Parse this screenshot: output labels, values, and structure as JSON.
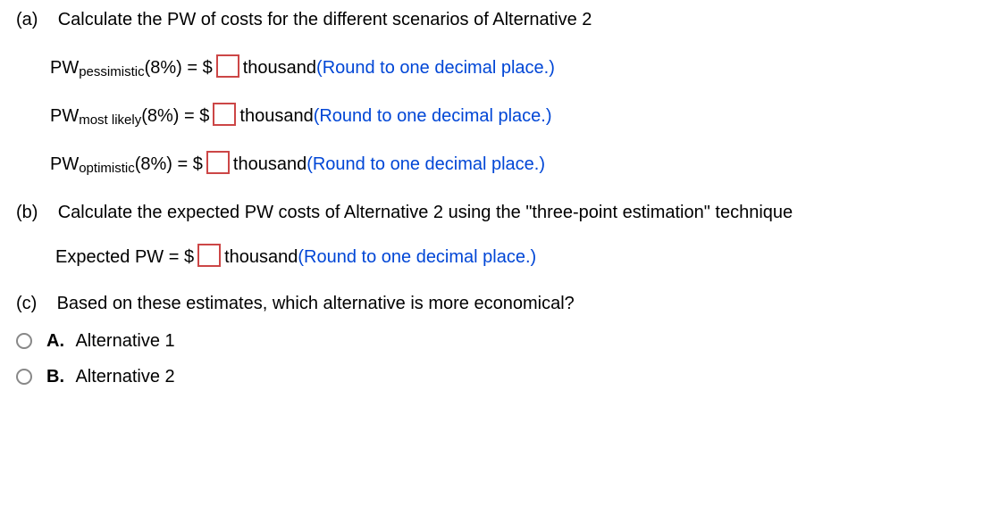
{
  "partA": {
    "label": "(a)",
    "question": "Calculate the PW of costs for the different scenarios of Alternative 2",
    "rows": [
      {
        "prefix": "PW",
        "subscript": "pessimistic",
        "rate": "(8%) = $",
        "unit": " thousand ",
        "hint": "(Round to one decimal place.)"
      },
      {
        "prefix": "PW",
        "subscript": "most likely",
        "rate": "(8%) = $",
        "unit": " thousand ",
        "hint": "(Round to one decimal place.)"
      },
      {
        "prefix": "PW",
        "subscript": "optimistic",
        "rate": "(8%) = $",
        "unit": " thousand ",
        "hint": "(Round to one decimal place.)"
      }
    ]
  },
  "partB": {
    "label": "(b)",
    "question": "Calculate the expected PW costs of Alternative 2 using the \"three-point estimation\" technique",
    "row": {
      "prefix": "Expected PW = $",
      "unit": " thousand ",
      "hint": "(Round to one decimal place.)"
    }
  },
  "partC": {
    "label": "(c)",
    "question": "Based on these estimates, which alternative is more economical?",
    "options": [
      {
        "letter": "A.",
        "text": "Alternative 1"
      },
      {
        "letter": "B.",
        "text": "Alternative 2"
      }
    ]
  }
}
